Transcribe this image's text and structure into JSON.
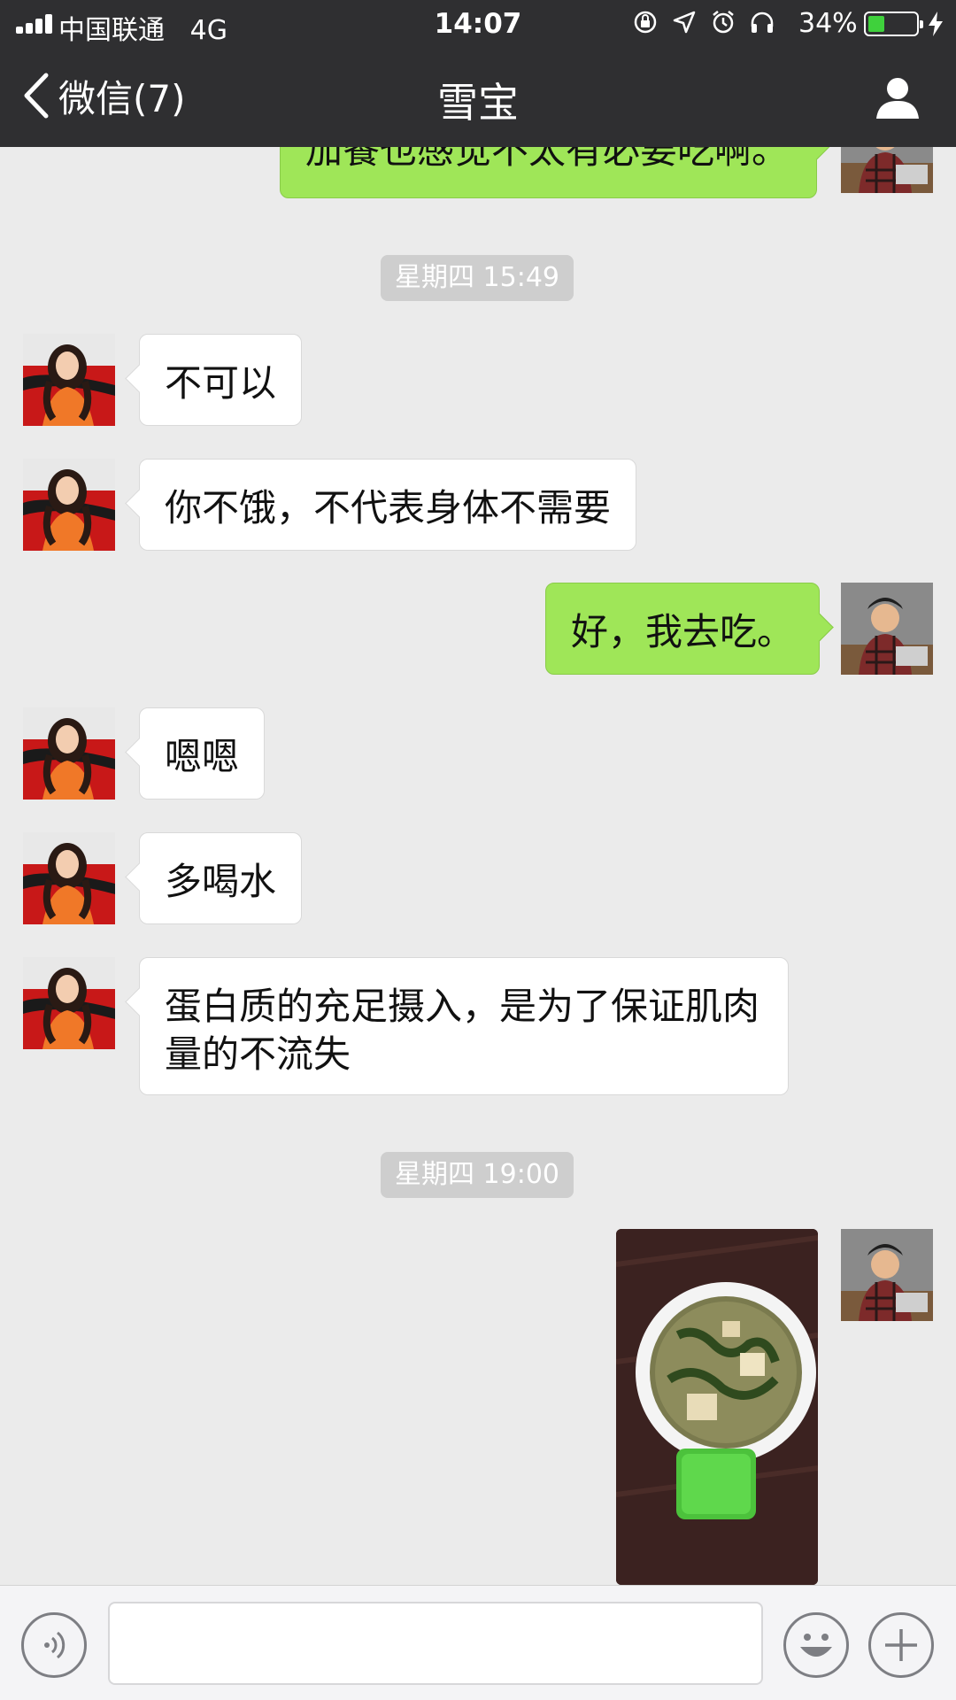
{
  "status_bar": {
    "carrier": "中国联通",
    "network": "4G",
    "time": "14:07",
    "battery_percent": "34%",
    "battery_level": 0.34,
    "icons": [
      "orientation-lock-icon",
      "location-icon",
      "alarm-icon",
      "headphones-icon",
      "battery-icon",
      "charging-icon"
    ]
  },
  "nav": {
    "back_label": "微信(7)",
    "title": "雪宝",
    "profile_icon": "person-icon"
  },
  "messages": [
    {
      "dir": "out",
      "text": "加餐也感觉不太有必要吃啊。"
    },
    {
      "type": "time",
      "text": "星期四 15:49"
    },
    {
      "dir": "in",
      "text": "不可以"
    },
    {
      "dir": "in",
      "text": "你不饿，不代表身体不需要"
    },
    {
      "dir": "out",
      "text": "好，我去吃。"
    },
    {
      "dir": "in",
      "text": "嗯嗯"
    },
    {
      "dir": "in",
      "text": "多喝水"
    },
    {
      "dir": "in",
      "text": "蛋白质的充足摄入，是为了保证肌肉量的不流失"
    },
    {
      "type": "time",
      "text": "星期四 19:00"
    },
    {
      "dir": "out",
      "type": "image",
      "description": "photo-of-soup-bowl"
    }
  ],
  "input_bar": {
    "voice_icon": "voice-icon",
    "emoji_icon": "emoji-icon",
    "plus_icon": "plus-icon",
    "text_value": ""
  },
  "colors": {
    "nav_bg": "#2f2f31",
    "chat_bg": "#ebebeb",
    "outgoing_bubble": "#9fe658",
    "incoming_bubble": "#ffffff",
    "timestamp_bg": "#cecece"
  }
}
